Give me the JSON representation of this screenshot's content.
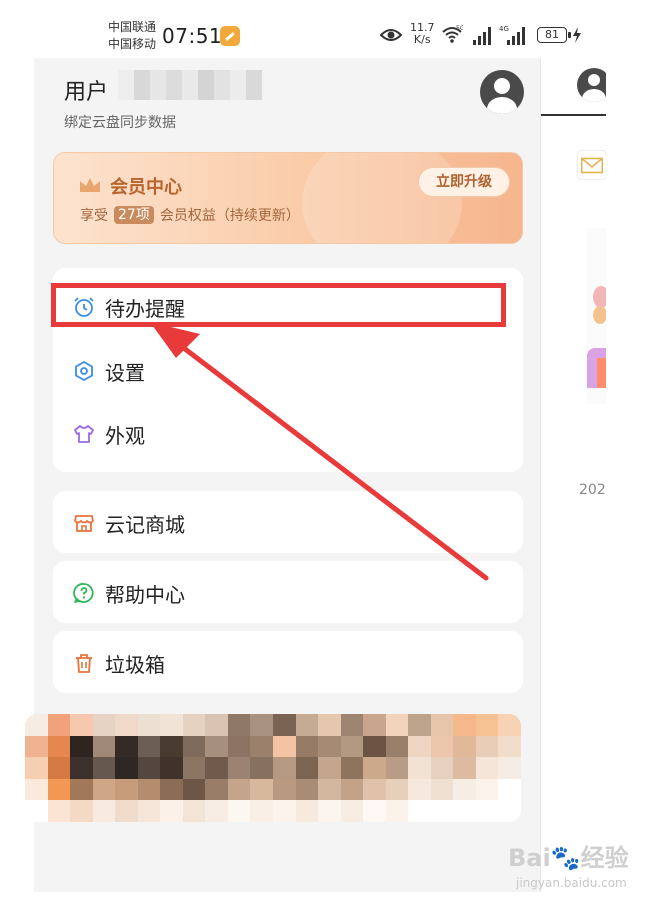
{
  "status_bar": {
    "carrier_1": "中国联通",
    "carrier_2": "中国移动",
    "time": "07:51",
    "net_speed_value": "11.7",
    "net_speed_unit": "K/s",
    "wifi_label": "5G",
    "cell_label": "4G",
    "battery_level": "81"
  },
  "drawer": {
    "user_label": "用户",
    "bind_hint": "绑定云盘同步数据",
    "vip": {
      "title": "会员中心",
      "desc_prefix": "享受",
      "count": "27项",
      "desc_suffix": "会员权益（持续更新）",
      "upgrade_button": "立即升级"
    },
    "menu_main": [
      {
        "label": "待办提醒",
        "icon": "alarm-clock-icon",
        "icon_color": "#3a8ee6"
      },
      {
        "label": "设置",
        "icon": "gear-icon",
        "icon_color": "#3a8ee6"
      },
      {
        "label": "外观",
        "icon": "shirt-icon",
        "icon_color": "#9b6be0"
      }
    ],
    "menu_shop": {
      "label": "云记商城",
      "icon": "store-icon",
      "icon_color": "#e8733a"
    },
    "menu_help": {
      "label": "帮助中心",
      "icon": "help-icon",
      "icon_color": "#2fb85a"
    },
    "menu_trash": {
      "label": "垃圾箱",
      "icon": "trash-icon",
      "icon_color": "#e8733a"
    }
  },
  "right_panel": {
    "year_text": "202"
  },
  "annotation": {
    "highlight_color": "#e83a3a"
  },
  "watermark": {
    "brand": "Bai",
    "brand_suffix": "经验",
    "url": "jingyan.baidu.com"
  }
}
